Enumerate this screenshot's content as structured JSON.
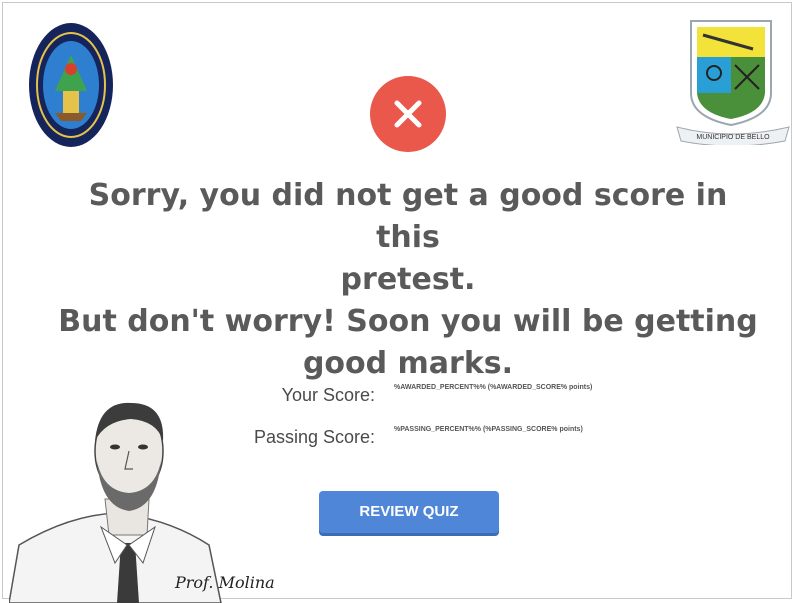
{
  "result": {
    "status_icon": "close-x-icon",
    "accent_color": "#e9584b",
    "message_line_1": "Sorry, you did not get a good score in this",
    "message_line_2": "pretest.",
    "message_line_3": "But don't worry! Soon you will be getting",
    "message_line_4": "good marks."
  },
  "scores": {
    "your_label": "Your Score:",
    "your_value": "%AWARDED_PERCENT%% (%AWARDED_SCORE% points)",
    "passing_label": "Passing Score:",
    "passing_value": "%PASSING_PERCENT%% (%PASSING_SCORE% points)"
  },
  "review_button": {
    "label": "REVIEW QUIZ",
    "color": "#4f86d8"
  },
  "teacher": {
    "signature": "Prof. Molina"
  },
  "logos": {
    "left": "institution-seal",
    "right": "municipio-de-bello-crest",
    "right_banner": "MUNICIPIO DE BELLO"
  }
}
